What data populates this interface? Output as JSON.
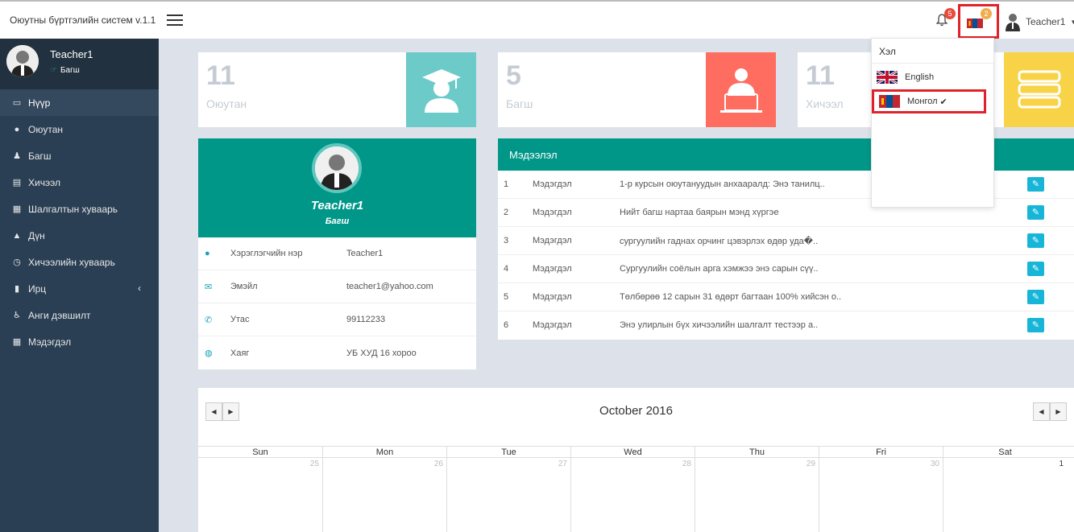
{
  "header": {
    "app_title": "Оюутны бүртгэлийн систем v.1.1",
    "notifications_count": "5",
    "language_count": "2",
    "user_name": "Teacher1"
  },
  "sidebar": {
    "profile_name": "Teacher1",
    "profile_role": "Багш",
    "items": [
      {
        "label": "Нүүр",
        "icon": "laptop-icon"
      },
      {
        "label": "Оюутан",
        "icon": "user-icon"
      },
      {
        "label": "Багш",
        "icon": "teacher-icon"
      },
      {
        "label": "Хичээл",
        "icon": "book-icon"
      },
      {
        "label": "Шалгалтын хуваарь",
        "icon": "sitemap-icon"
      },
      {
        "label": "Дүн",
        "icon": "flask-icon"
      },
      {
        "label": "Хичээлийн хуваарь",
        "icon": "clock-icon"
      },
      {
        "label": "Ирц",
        "icon": "mobile-icon"
      },
      {
        "label": "Анги дэвшилт",
        "icon": "blind-icon"
      },
      {
        "label": "Мэдэгдэл",
        "icon": "calendar-icon"
      }
    ]
  },
  "stats": [
    {
      "value": "11",
      "label": "Оюутан",
      "color": "#6ccac9"
    },
    {
      "value": "5",
      "label": "Багш",
      "color": "#ff6c60"
    },
    {
      "value": "11",
      "label": "Хичээл",
      "color": "#f8d347"
    }
  ],
  "profile_card": {
    "name": "Teacher1",
    "role": "Багш",
    "rows": [
      {
        "key": "Хэрэглэгчийн нэр",
        "value": "Teacher1"
      },
      {
        "key": "Эмэйл",
        "value": "teacher1@yahoo.com"
      },
      {
        "key": "Утас",
        "value": "99112233"
      },
      {
        "key": "Хаяг",
        "value": "УБ ХУД 16 хороо"
      }
    ]
  },
  "notices": {
    "title": "Мэдээлэл",
    "rows": [
      {
        "no": "1",
        "type": "Мэдэгдэл",
        "text": "1-р курсын оюутануудын анхааралд: Энэ танилц.."
      },
      {
        "no": "2",
        "type": "Мэдэгдэл",
        "text": "Нийт багш нартаа баярын мэнд хүргэе"
      },
      {
        "no": "3",
        "type": "Мэдэгдэл",
        "text": "сургуулийн гаднах орчинг цэвэрлэх өдөр уда�.."
      },
      {
        "no": "4",
        "type": "Мэдэгдэл",
        "text": "Сургуулийн соёлын арга хэмжээ энэ сарын сүү.."
      },
      {
        "no": "5",
        "type": "Мэдэгдэл",
        "text": "Төлбөрөө 12 сарын 31 өдөрт багтаан 100% хийсэн о.."
      },
      {
        "no": "6",
        "type": "Мэдэгдэл",
        "text": "Энэ улирлын бүх хичээлийн шалгалт тестээр а.."
      }
    ]
  },
  "calendar": {
    "title": "October 2016",
    "days": [
      "Sun",
      "Mon",
      "Tue",
      "Wed",
      "Thu",
      "Fri",
      "Sat"
    ],
    "first_week": [
      "25",
      "26",
      "27",
      "28",
      "29",
      "30",
      "1"
    ]
  },
  "language_dropdown": {
    "header": "Хэл",
    "options": [
      {
        "label": "English",
        "selected": false
      },
      {
        "label": "Монгол",
        "selected": true,
        "check": "✔"
      }
    ]
  }
}
